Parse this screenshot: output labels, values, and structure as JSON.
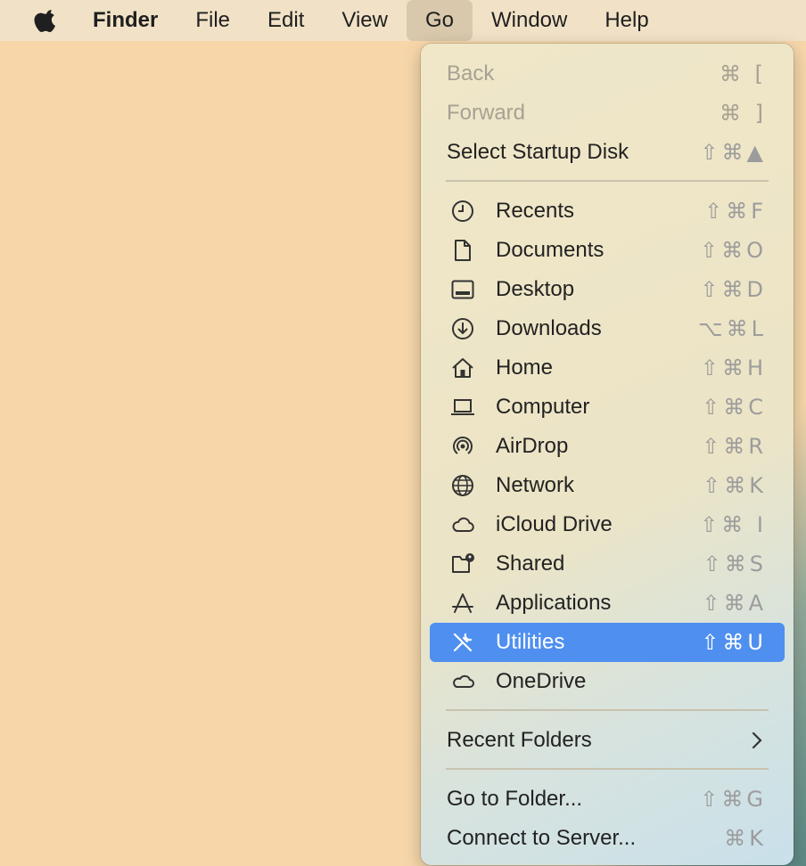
{
  "menubar": {
    "app_name": "Finder",
    "menus": [
      "File",
      "Edit",
      "View",
      "Go",
      "Window",
      "Help"
    ]
  },
  "go_menu": {
    "items": [
      {
        "label": "Back",
        "shortcut": "⌘ [",
        "icon": null,
        "disabled": true
      },
      {
        "label": "Forward",
        "shortcut": "⌘ ]",
        "icon": null,
        "disabled": true
      },
      {
        "label": "Select Startup Disk",
        "shortcut": "⇧⌘▲",
        "icon": null,
        "disabled": false
      },
      {
        "label": "Recents",
        "shortcut": "⇧⌘F",
        "icon": "clock-icon"
      },
      {
        "label": "Documents",
        "shortcut": "⇧⌘O",
        "icon": "document-icon"
      },
      {
        "label": "Desktop",
        "shortcut": "⇧⌘D",
        "icon": "desktop-icon"
      },
      {
        "label": "Downloads",
        "shortcut": "⌥⌘L",
        "icon": "download-icon"
      },
      {
        "label": "Home",
        "shortcut": "⇧⌘H",
        "icon": "home-icon"
      },
      {
        "label": "Computer",
        "shortcut": "⇧⌘C",
        "icon": "laptop-icon"
      },
      {
        "label": "AirDrop",
        "shortcut": "⇧⌘R",
        "icon": "airdrop-icon"
      },
      {
        "label": "Network",
        "shortcut": "⇧⌘K",
        "icon": "globe-icon"
      },
      {
        "label": "iCloud Drive",
        "shortcut": "⇧⌘ I",
        "icon": "cloud-icon"
      },
      {
        "label": "Shared",
        "shortcut": "⇧⌘S",
        "icon": "shared-folder-icon"
      },
      {
        "label": "Applications",
        "shortcut": "⇧⌘A",
        "icon": "applications-icon"
      },
      {
        "label": "Utilities",
        "shortcut": "⇧⌘U",
        "icon": "tools-icon",
        "selected": true
      },
      {
        "label": "OneDrive",
        "shortcut": "",
        "icon": "onedrive-cloud-icon"
      },
      {
        "label": "Recent Folders",
        "shortcut": "",
        "icon": null,
        "submenu": true
      },
      {
        "label": "Go to Folder...",
        "shortcut": "⇧⌘G",
        "icon": null
      },
      {
        "label": "Connect to Server...",
        "shortcut": "⌘K",
        "icon": null
      }
    ]
  },
  "colors": {
    "desktop": "#f7d7aa",
    "selection": "#4f8ff0"
  }
}
